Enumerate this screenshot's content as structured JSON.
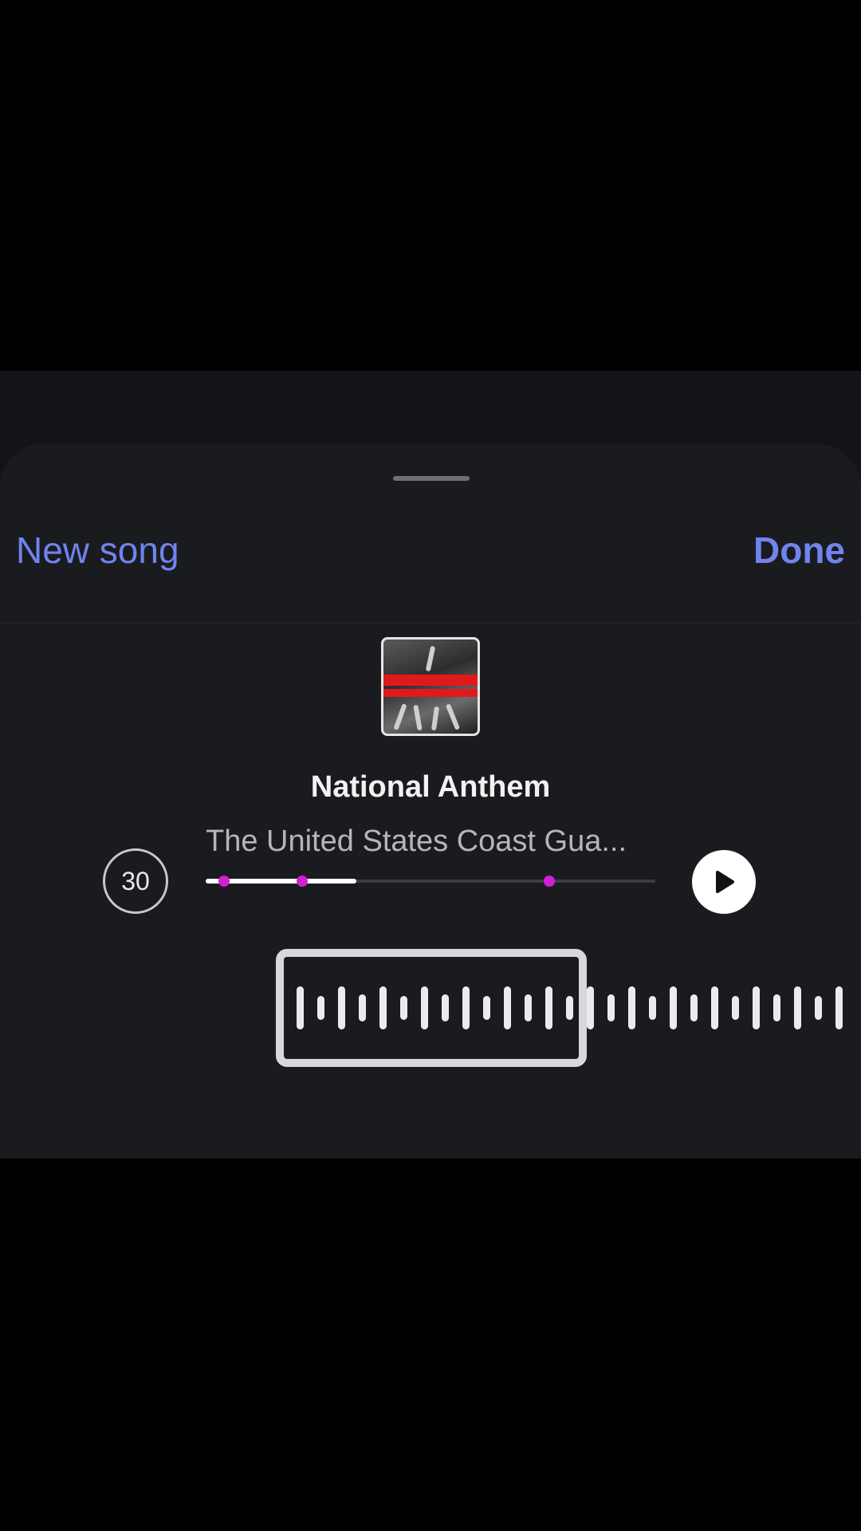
{
  "header": {
    "new_song_label": "New song",
    "done_label": "Done"
  },
  "song": {
    "title": "National Anthem",
    "artist": "The United States Coast Gua...",
    "artwork_icon": "album-artwork"
  },
  "clip": {
    "duration_label": "30",
    "progress_fraction": 0.335,
    "marker_fractions": [
      0.04,
      0.215,
      0.765
    ]
  },
  "controls": {
    "play_icon": "play-icon"
  },
  "colors": {
    "accent": "#7083ee",
    "marker": "#d21fd6",
    "sheet_background": "#1a1b1f"
  }
}
